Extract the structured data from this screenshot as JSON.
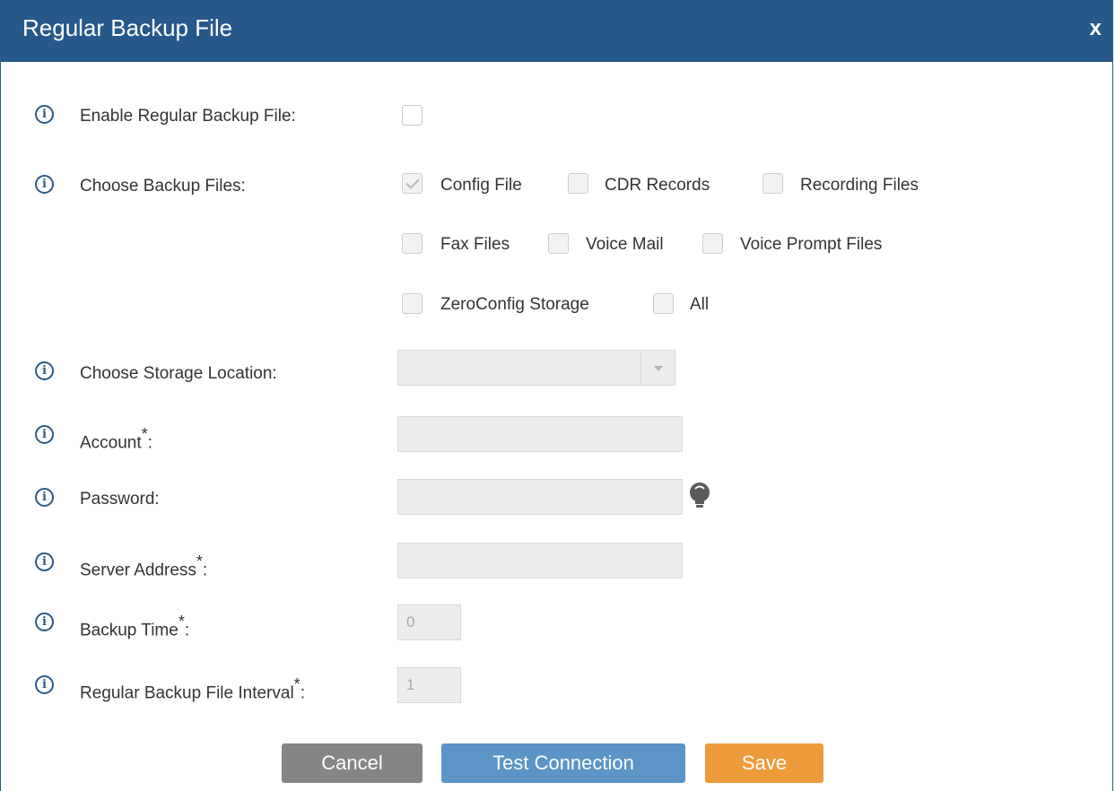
{
  "dialog": {
    "title": "Regular Backup File",
    "close_label": "x"
  },
  "form": {
    "enable": {
      "label": "Enable Regular Backup File:",
      "checked": false
    },
    "choose_files": {
      "label": "Choose Backup Files:",
      "options": [
        {
          "label": "Config File",
          "checked": true,
          "disabled": true
        },
        {
          "label": "CDR Records",
          "checked": false
        },
        {
          "label": "Recording Files",
          "checked": false
        },
        {
          "label": "Fax Files",
          "checked": false
        },
        {
          "label": "Voice Mail",
          "checked": false
        },
        {
          "label": "Voice Prompt Files",
          "checked": false
        },
        {
          "label": "ZeroConfig Storage",
          "checked": false
        },
        {
          "label": "All",
          "checked": false
        }
      ]
    },
    "storage": {
      "label": "Choose Storage Location:",
      "value": ""
    },
    "account": {
      "label": "Account",
      "required_mark": "*",
      "suffix": ":",
      "value": ""
    },
    "password": {
      "label": "Password:",
      "value": ""
    },
    "server": {
      "label": "Server Address",
      "required_mark": "*",
      "suffix": ":",
      "value": ""
    },
    "backup_time": {
      "label": "Backup Time",
      "required_mark": "*",
      "suffix": ":",
      "value": "0"
    },
    "interval": {
      "label": "Regular Backup File Interval",
      "required_mark": "*",
      "suffix": ":",
      "value": "1"
    }
  },
  "buttons": {
    "cancel": "Cancel",
    "test": "Test Connection",
    "save": "Save"
  },
  "icons": {
    "info": "info-icon",
    "password_hint": "lightbulb-icon"
  },
  "colors": {
    "titlebar": "#27588a",
    "cancel": "#858585",
    "test": "#5b94c6",
    "save": "#ee9b3c"
  }
}
